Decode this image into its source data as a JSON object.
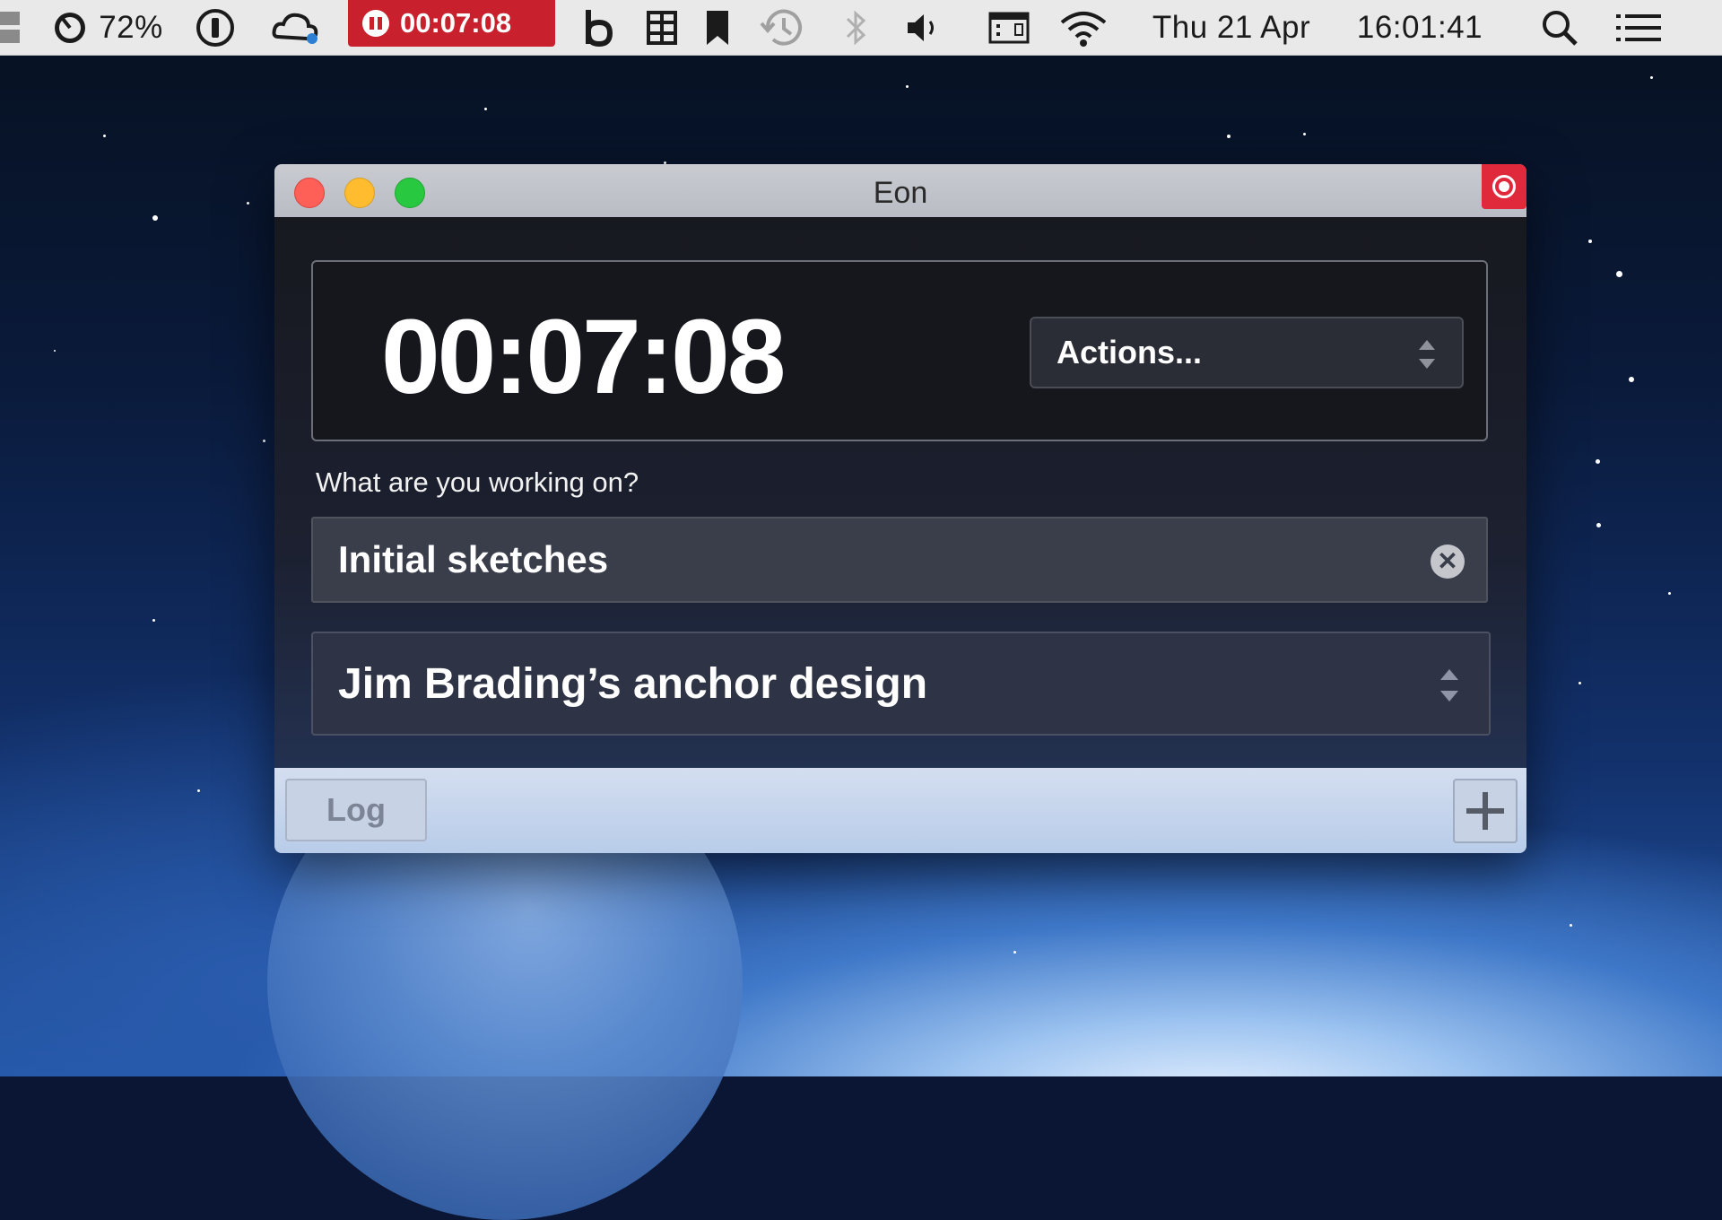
{
  "menubar": {
    "battery_percent": "72%",
    "timer": "00:07:08",
    "date": "Thu 21 Apr",
    "time": "16:01:41"
  },
  "window": {
    "title": "Eon",
    "timer_display": "00:07:08",
    "actions_label": "Actions...",
    "prompt": "What are you working on?",
    "task_value": "Initial sketches",
    "project_value": "Jim Brading’s anchor design",
    "log_label": "Log"
  },
  "colors": {
    "record_red": "#e02a3c",
    "menubar_timer_red": "#c8202c",
    "close": "#fe5f57",
    "minimize": "#febc2e",
    "zoom": "#28c840"
  },
  "icons": {
    "menubar": [
      "battery-gauge-icon",
      "info-icon",
      "creative-cloud-icon",
      "pause-icon",
      "b-app-icon",
      "grid-icon",
      "bookmark-icon",
      "time-machine-icon",
      "bluetooth-icon",
      "volume-icon",
      "keyboard-icon",
      "wifi-icon",
      "search-icon",
      "list-icon"
    ],
    "window": [
      "record-icon",
      "chevron-updown-icon",
      "clear-icon",
      "plus-icon"
    ]
  }
}
